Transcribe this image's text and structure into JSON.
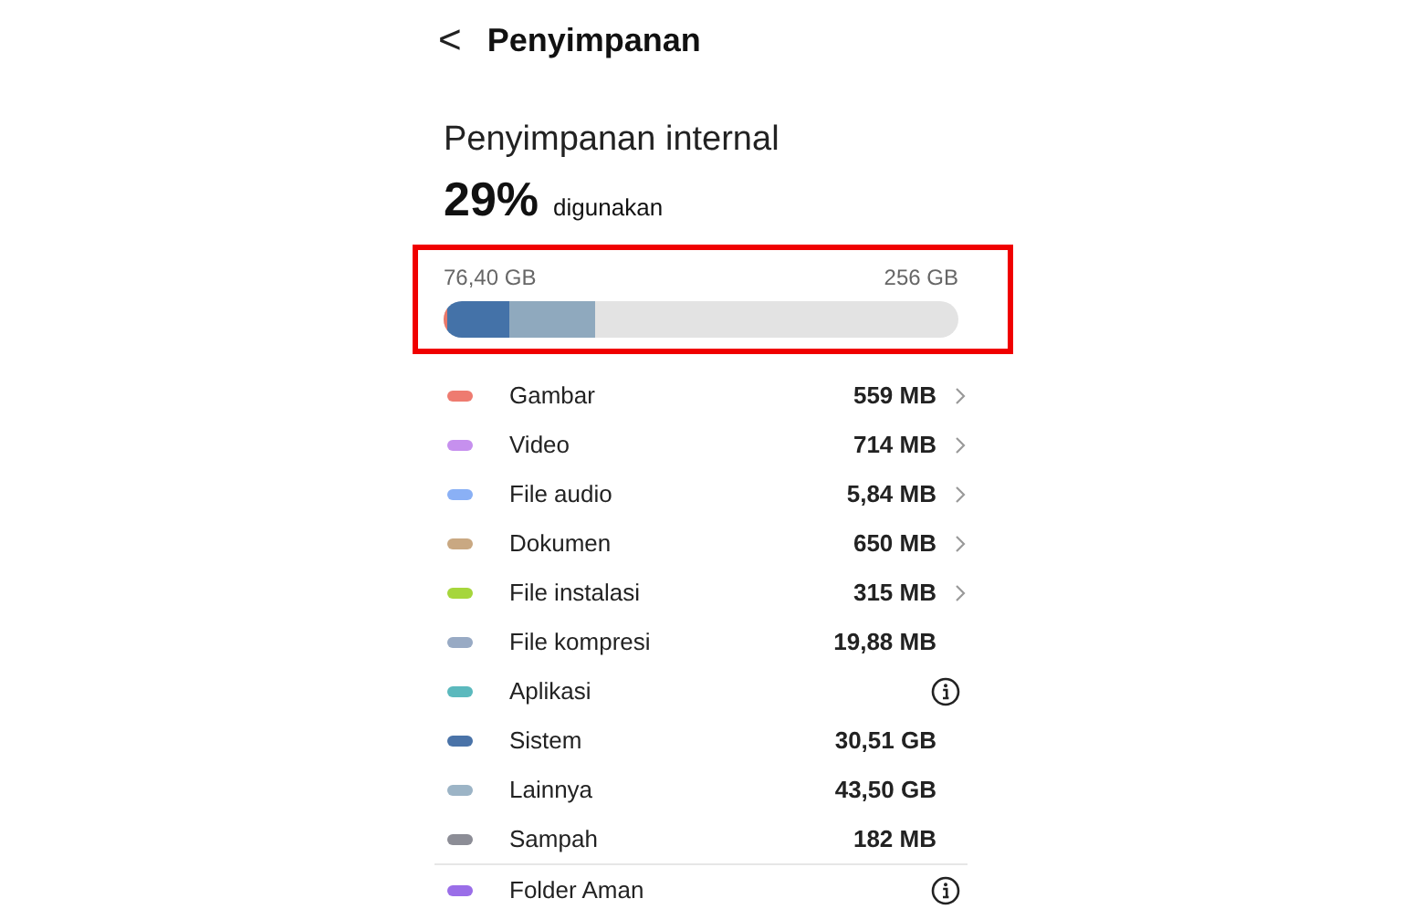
{
  "header": {
    "back_glyph": "<",
    "title": "Penyimpanan"
  },
  "storage": {
    "title": "Penyimpanan internal",
    "percent": "29%",
    "percent_label": "digunakan",
    "used": "76,40 GB",
    "total": "256 GB",
    "highlighted": true,
    "segments": [
      {
        "color": "#e8786a",
        "level": 0.006
      },
      {
        "color": "#4472a8",
        "level": 0.12
      },
      {
        "color": "#8fa9be",
        "level": 0.17
      }
    ]
  },
  "items": [
    {
      "label": "Gambar",
      "color": "#ee7b70",
      "kind": "value",
      "value": "559 MB",
      "chevron": true
    },
    {
      "label": "Video",
      "color": "#c690ee",
      "kind": "value",
      "value": "714 MB",
      "chevron": true
    },
    {
      "label": "File audio",
      "color": "#8ab0f5",
      "kind": "value",
      "value": "5,84 MB",
      "chevron": true
    },
    {
      "label": "Dokumen",
      "color": "#c9a882",
      "kind": "value",
      "value": "650 MB",
      "chevron": true
    },
    {
      "label": "File instalasi",
      "color": "#a6d63c",
      "kind": "value",
      "value": "315 MB",
      "chevron": true
    },
    {
      "label": "File kompresi",
      "color": "#98aac4",
      "kind": "value",
      "value": "19,88 MB",
      "chevron": false
    },
    {
      "label": "Aplikasi",
      "color": "#5bb9bd",
      "kind": "info",
      "chevron": false
    },
    {
      "label": "Sistem",
      "color": "#4a73a8",
      "kind": "value",
      "value": "30,51 GB",
      "chevron": false
    },
    {
      "label": "Lainnya",
      "color": "#9cb4c6",
      "kind": "value",
      "value": "43,50 GB",
      "chevron": false
    },
    {
      "label": "Sampah",
      "color": "#8c8d96",
      "kind": "value",
      "value": "182 MB",
      "chevron": false
    }
  ],
  "secure_items": [
    {
      "label": "Folder Aman",
      "color": "#9a6ee8",
      "kind": "info",
      "chevron": false
    }
  ]
}
